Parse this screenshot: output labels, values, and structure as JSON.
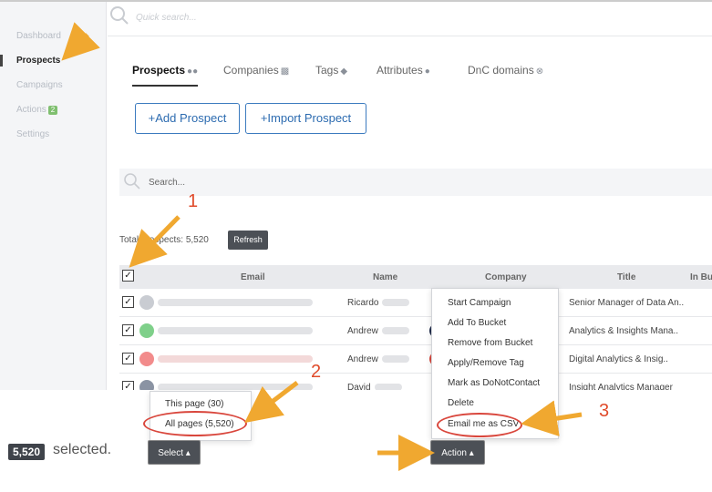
{
  "sidebar": {
    "items": [
      {
        "label": "Dashboard"
      },
      {
        "label": "Prospects"
      },
      {
        "label": "Campaigns"
      },
      {
        "label": "Actions",
        "badge": "2"
      },
      {
        "label": "Settings"
      }
    ]
  },
  "search": {
    "quick_placeholder": "Quick search...",
    "table_placeholder": "Search..."
  },
  "tabs": [
    {
      "label": "Prospects",
      "icon": "users-icon"
    },
    {
      "label": "Companies",
      "icon": "building-icon"
    },
    {
      "label": "Tags",
      "icon": "tag-icon"
    },
    {
      "label": "Attributes",
      "icon": "user-edit-icon"
    },
    {
      "label": "DnC domains",
      "icon": "close-circle-icon"
    }
  ],
  "buttons": {
    "add_prospect": "+Add Prospect",
    "import_prospect": "+Import Prospect",
    "refresh": "Refresh",
    "select": "Select ▴",
    "action": "Action ▴"
  },
  "total": "Total prospects: 5,520",
  "table": {
    "headers": [
      "Email",
      "Name",
      "Company",
      "Title",
      "In Bu"
    ],
    "rows": [
      {
        "name": "Ricardo",
        "title": "Senior Manager of Data An..",
        "avatar_color": "#c9ccd2"
      },
      {
        "name": "Andrew",
        "title": "Analytics & Insights Mana..",
        "avatar_color": "#7fd08a"
      },
      {
        "name": "Andrew",
        "title": "Digital Analytics & Insig..",
        "avatar_color": "#f28b8b"
      },
      {
        "name": "David",
        "title": "Insight Analytics Manager",
        "avatar_color": "#8a93a3"
      }
    ]
  },
  "action_menu": [
    "Start Campaign",
    "Add To Bucket",
    "Remove from Bucket",
    "Apply/Remove Tag",
    "Mark as DoNotContact",
    "Delete",
    "Email me as CSV"
  ],
  "select_menu": [
    "This page (30)",
    "All pages (5,520)"
  ],
  "selection": {
    "count": "5,520",
    "text": "selected."
  },
  "annotations": {
    "step1": "1",
    "step2": "2",
    "step3": "3",
    "arrow_color": "#f0a830",
    "ellipse_color": "#d9473d"
  }
}
